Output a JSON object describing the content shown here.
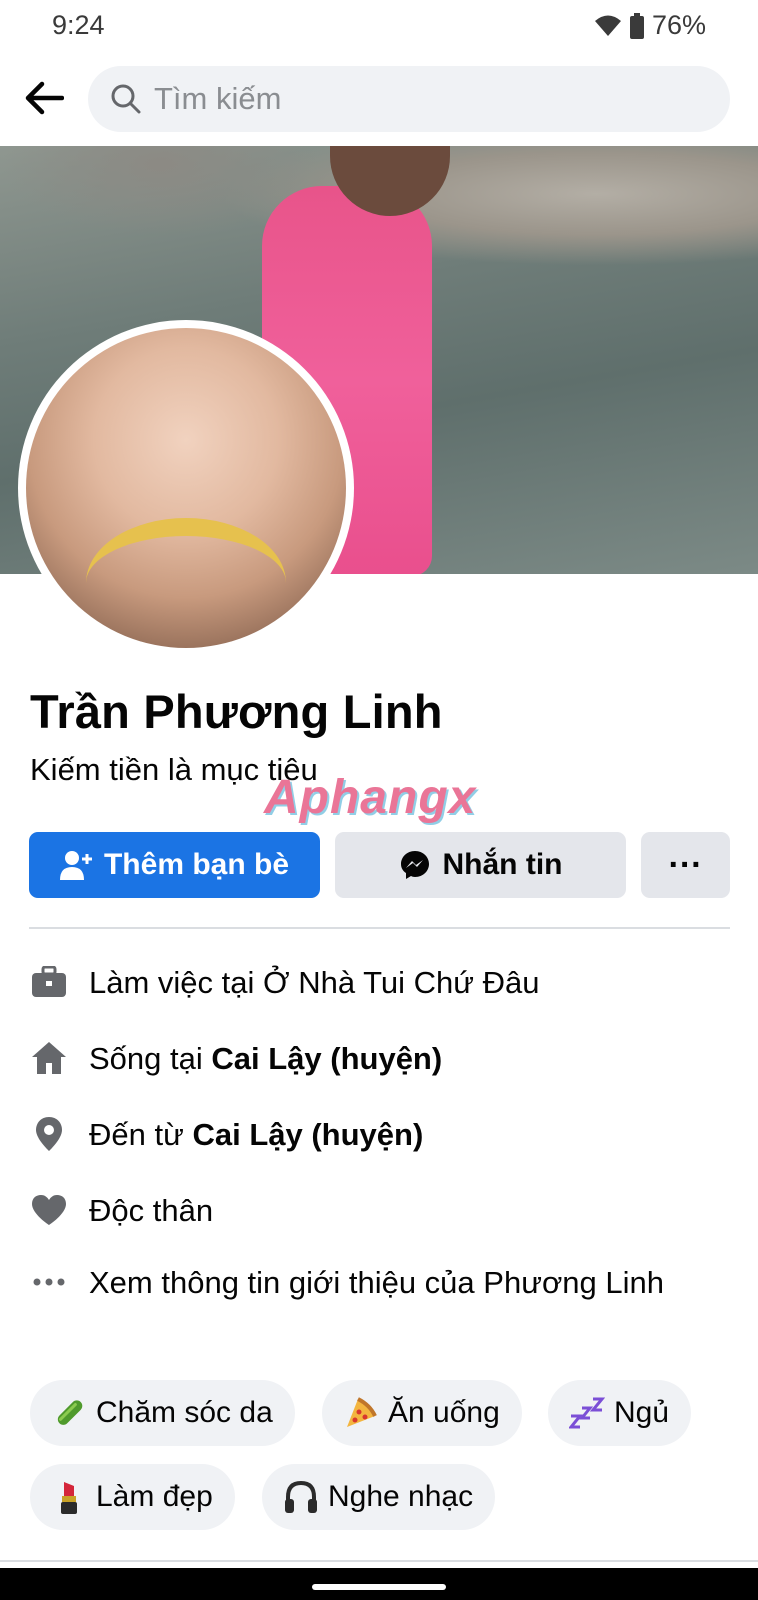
{
  "status_bar": {
    "time": "9:24",
    "battery": "76%"
  },
  "header": {
    "search_placeholder": "Tìm kiếm"
  },
  "profile": {
    "name": "Trần Phương Linh",
    "bio": "Kiếm tiền là mục tiêu",
    "watermark": "Aphangx"
  },
  "actions": {
    "add_friend": "Thêm bạn bè",
    "message": "Nhắn tin",
    "more": "···"
  },
  "intro": {
    "work_prefix": "Làm việc tại Ở Nhà Tui Chứ Đâu",
    "lives_prefix": "Sống tại ",
    "lives_place": "Cai Lậy (huyện)",
    "from_prefix": "Đến từ ",
    "from_place": "Cai Lậy (huyện)",
    "relationship": "Độc thân",
    "see_about": "Xem thông tin giới thiệu của Phương Linh"
  },
  "hobbies": [
    {
      "label": "Chăm sóc da",
      "icon": "cucumber-icon"
    },
    {
      "label": "Ăn uống",
      "icon": "pizza-icon"
    },
    {
      "label": "Ngủ",
      "icon": "zzz-icon"
    },
    {
      "label": "Làm đẹp",
      "icon": "lipstick-icon"
    },
    {
      "label": "Nghe nhạc",
      "icon": "headphones-icon"
    }
  ],
  "colors": {
    "primary": "#1b74e4",
    "secondary_button": "#e4e6eb",
    "chip_bg": "#f0f2f5",
    "icon_gray": "#65676b"
  }
}
